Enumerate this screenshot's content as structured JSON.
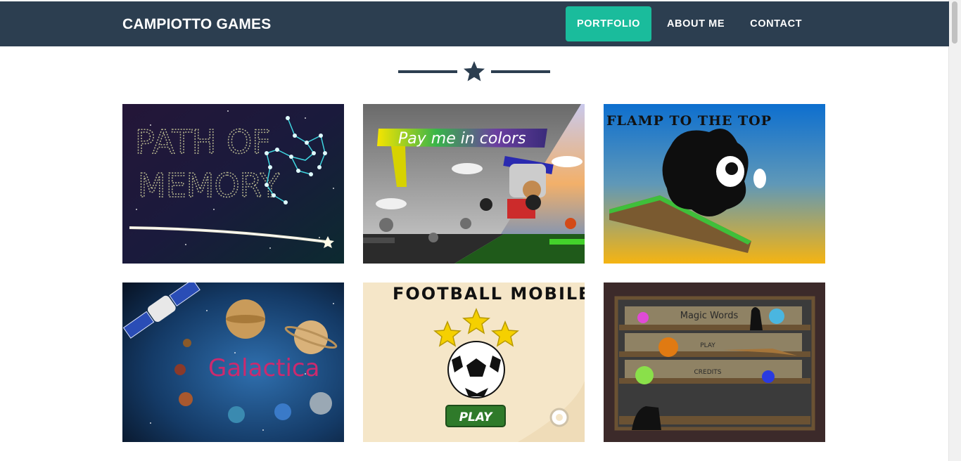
{
  "brand": "CAMPIOTTO GAMES",
  "nav": [
    {
      "label": "PORTFOLIO",
      "active": true
    },
    {
      "label": "ABOUT ME",
      "active": false
    },
    {
      "label": "CONTACT",
      "active": false
    }
  ],
  "colors": {
    "navbar": "#2c3e50",
    "accent": "#1abc9c",
    "divider": "#2c3e50"
  },
  "divider_icon": "star-icon",
  "portfolio": [
    {
      "id": "path-of-memory",
      "title_line1": "PATH OF",
      "title_line2": "MEMORY"
    },
    {
      "id": "pay-me-in-colors",
      "title": "Pay me in colors"
    },
    {
      "id": "flamp-to-the-top",
      "title": "FLAMP TO THE TOP"
    },
    {
      "id": "galactica",
      "title": "Galactica"
    },
    {
      "id": "football-mobile",
      "title": "FOOTBALL MOBILE",
      "play": "PLAY"
    },
    {
      "id": "magic-words",
      "title": "Magic Words",
      "play": "PLAY",
      "credits": "CREDITS"
    }
  ]
}
